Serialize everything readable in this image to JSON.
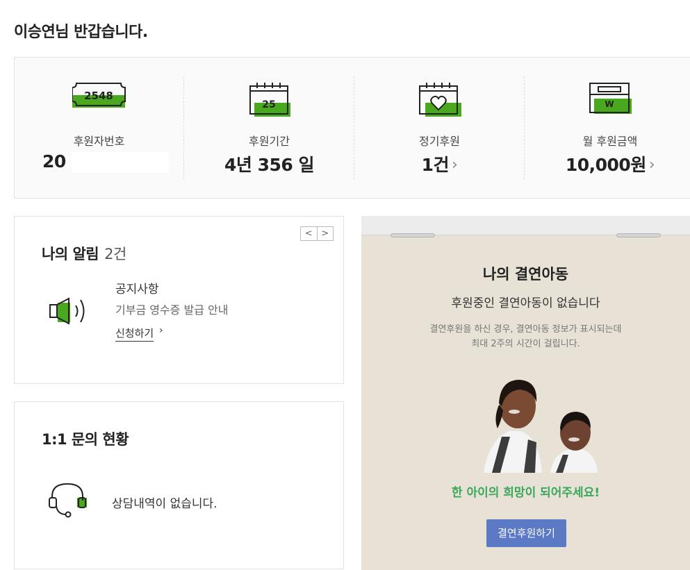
{
  "greeting": "이승연님 반갑습니다.",
  "stats": [
    {
      "icon": "ticket-icon",
      "icon_text": "2548",
      "label": "후원자번호",
      "value": "20"
    },
    {
      "icon": "calendar-icon",
      "icon_text": "25",
      "label": "후원기간",
      "value": "4년 356 일"
    },
    {
      "icon": "heart-calendar-icon",
      "label": "정기후원",
      "value": "1건"
    },
    {
      "icon": "wallet-icon",
      "icon_text": "W",
      "label": "월 후원금액",
      "value": "10,000원"
    }
  ],
  "notice": {
    "title": "나의 알림",
    "count": "2건",
    "pager_prev": "<",
    "pager_next": ">",
    "item_type": "공지사항",
    "item_text": "기부금 영수증 발급 안내",
    "item_link": "신청하기"
  },
  "inquiry": {
    "title": "1:1 문의 현황",
    "empty_text": "상담내역이 없습니다."
  },
  "child": {
    "title": "나의 결연아동",
    "subtitle": "후원중인 결연아동이 없습니다",
    "desc_line1": "결연후원을 하신 경우, 결연아동 정보가 표시되는데",
    "desc_line2": "최대 2주의 시간이 걸립니다.",
    "hope": "한 아이의 희망이 되어주세요!",
    "button": "결연후원하기"
  },
  "colors": {
    "accent_green": "#4aa81e",
    "hope_green": "#3aa85a",
    "button_blue": "#5b79c4"
  }
}
